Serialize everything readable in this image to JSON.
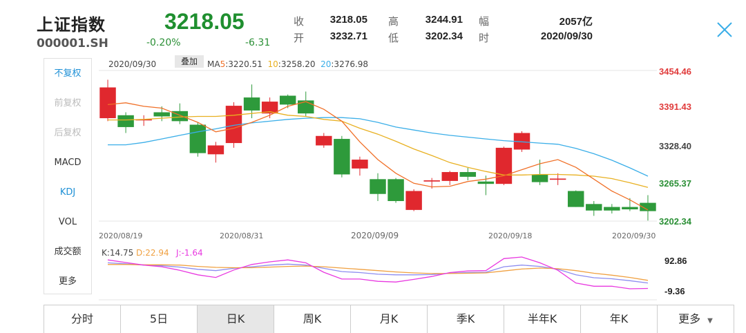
{
  "header": {
    "name": "上证指数",
    "code": "000001.SH",
    "price": "3218.05",
    "change_pct": "-0.20%",
    "change": "-6.31",
    "stats": [
      {
        "label": "收",
        "value": "3218.05"
      },
      {
        "label": "高",
        "value": "3244.91"
      },
      {
        "label": "幅",
        "value": "2057亿"
      },
      {
        "label": "开",
        "value": "3232.71"
      },
      {
        "label": "低",
        "value": "3202.34"
      },
      {
        "label": "时",
        "value": "2020/09/30"
      }
    ]
  },
  "sidebar": {
    "items": [
      {
        "label": "不复权",
        "state": "selected"
      },
      {
        "label": "前复权",
        "state": "disabled"
      },
      {
        "label": "后复权",
        "state": "disabled"
      },
      {
        "label": "MACD",
        "state": "normal"
      },
      {
        "label": "KDJ",
        "state": "selected"
      },
      {
        "label": "VOL",
        "state": "normal"
      },
      {
        "label": "成交额",
        "state": "normal"
      },
      {
        "label": "更多",
        "state": "normal"
      }
    ]
  },
  "legend": {
    "date": "2020/09/30",
    "overlay_button": "叠加",
    "ma5_prefix": "MA",
    "ma5_num": "5",
    "ma5_value": ":3220.51",
    "ma10_num": "10",
    "ma10_value": ":3258.20",
    "ma20_num": "20",
    "ma20_value": ":3276.98"
  },
  "price_axis": {
    "ticks": [
      "3454.46",
      "3391.43",
      "3328.40",
      "3265.37",
      "3202.34"
    ],
    "tick_colors": [
      "#e03a3a",
      "#e03a3a",
      "#444444",
      "#2a8f35",
      "#2a8f35"
    ]
  },
  "date_axis": [
    "2020/08/19",
    "2020/08/31",
    "2020/09/09",
    "2020/09/18",
    "2020/09/30"
  ],
  "kdj": {
    "k_label": "K:14.75",
    "d_label": "D:22.94",
    "j_label": "J:-1.64",
    "ticks": [
      "92.86",
      "-9.36"
    ]
  },
  "tabs": [
    "分时",
    "5日",
    "日K",
    "周K",
    "月K",
    "季K",
    "半年K",
    "年K",
    "更多"
  ],
  "active_tab": "日K",
  "colors": {
    "up": "#e0282e",
    "down": "#2e9a3b",
    "ma5": "#f07028",
    "ma10": "#e8b020",
    "ma20": "#3aaee8",
    "k": "#8c8cf0",
    "d": "#f0a040",
    "j": "#e838e0",
    "accent": "#1e90d6"
  },
  "chart_data": {
    "type": "candlestick",
    "ylim": [
      3202.34,
      3454.46
    ],
    "candles": [
      {
        "o": 3375,
        "c": 3427,
        "h": 3440,
        "l": 3370
      },
      {
        "o": 3380,
        "c": 3360,
        "h": 3385,
        "l": 3350
      },
      {
        "o": 3372,
        "c": 3373,
        "h": 3380,
        "l": 3362
      },
      {
        "o": 3385,
        "c": 3378,
        "h": 3395,
        "l": 3370
      },
      {
        "o": 3387,
        "c": 3370,
        "h": 3400,
        "l": 3365
      },
      {
        "o": 3364,
        "c": 3316,
        "h": 3368,
        "l": 3310
      },
      {
        "o": 3314,
        "c": 3329,
        "h": 3335,
        "l": 3300
      },
      {
        "o": 3333,
        "c": 3396,
        "h": 3402,
        "l": 3325
      },
      {
        "o": 3410,
        "c": 3388,
        "h": 3432,
        "l": 3375
      },
      {
        "o": 3383,
        "c": 3403,
        "h": 3410,
        "l": 3375
      },
      {
        "o": 3413,
        "c": 3398,
        "h": 3415,
        "l": 3392
      },
      {
        "o": 3405,
        "c": 3383,
        "h": 3420,
        "l": 3378
      },
      {
        "o": 3329,
        "c": 3345,
        "h": 3350,
        "l": 3325
      },
      {
        "o": 3340,
        "c": 3280,
        "h": 3345,
        "l": 3275
      },
      {
        "o": 3290,
        "c": 3305,
        "h": 3310,
        "l": 3278
      },
      {
        "o": 3272,
        "c": 3247,
        "h": 3282,
        "l": 3235
      },
      {
        "o": 3272,
        "c": 3235,
        "h": 3274,
        "l": 3232
      },
      {
        "o": 3220,
        "c": 3252,
        "h": 3255,
        "l": 3218
      },
      {
        "o": 3268,
        "c": 3270,
        "h": 3274,
        "l": 3256
      },
      {
        "o": 3269,
        "c": 3284,
        "h": 3286,
        "l": 3262
      },
      {
        "o": 3284,
        "c": 3276,
        "h": 3291,
        "l": 3270
      },
      {
        "o": 3268,
        "c": 3264,
        "h": 3278,
        "l": 3245
      },
      {
        "o": 3264,
        "c": 3325,
        "h": 3327,
        "l": 3262
      },
      {
        "o": 3322,
        "c": 3350,
        "h": 3353,
        "l": 3318
      },
      {
        "o": 3280,
        "c": 3267,
        "h": 3305,
        "l": 3262
      },
      {
        "o": 3271,
        "c": 3273,
        "h": 3282,
        "l": 3262
      },
      {
        "o": 3252,
        "c": 3225,
        "h": 3253,
        "l": 3225
      },
      {
        "o": 3230,
        "c": 3219,
        "h": 3235,
        "l": 3210
      },
      {
        "o": 3225,
        "c": 3219,
        "h": 3230,
        "l": 3214
      },
      {
        "o": 3225,
        "c": 3221,
        "h": 3240,
        "l": 3218
      },
      {
        "o": 3232,
        "c": 3218,
        "h": 3245,
        "l": 3202
      }
    ],
    "ma5": [
      3398,
      3401,
      3395,
      3392,
      3380,
      3368,
      3352,
      3358,
      3368,
      3380,
      3395,
      3403,
      3390,
      3370,
      3335,
      3305,
      3282,
      3265,
      3259,
      3260,
      3268,
      3272,
      3278,
      3288,
      3298,
      3305,
      3292,
      3272,
      3252,
      3237,
      3220
    ],
    "ma10": [
      3372,
      3372,
      3373,
      3375,
      3377,
      3378,
      3378,
      3380,
      3383,
      3386,
      3380,
      3378,
      3373,
      3370,
      3358,
      3348,
      3336,
      3323,
      3312,
      3300,
      3292,
      3285,
      3279,
      3279,
      3280,
      3280,
      3279,
      3277,
      3273,
      3266,
      3258
    ],
    "ma20": [
      3330,
      3330,
      3334,
      3340,
      3346,
      3352,
      3357,
      3363,
      3367,
      3370,
      3373,
      3375,
      3376,
      3376,
      3374,
      3368,
      3360,
      3355,
      3350,
      3346,
      3343,
      3340,
      3337,
      3335,
      3333,
      3331,
      3324,
      3315,
      3304,
      3291,
      3277
    ],
    "k": [
      77,
      74,
      70,
      68,
      64,
      57,
      53,
      60,
      65,
      70,
      73,
      70,
      60,
      50,
      47,
      42,
      40,
      40,
      41,
      45,
      47,
      48,
      65,
      70,
      66,
      57,
      40,
      31,
      28,
      22,
      15
    ],
    "d": [
      72,
      72,
      71,
      71,
      70,
      66,
      63,
      62,
      62,
      64,
      66,
      67,
      65,
      61,
      57,
      53,
      49,
      46,
      44,
      44,
      45,
      46,
      52,
      58,
      61,
      59,
      53,
      45,
      39,
      32,
      23
    ],
    "j": [
      86,
      78,
      70,
      65,
      54,
      40,
      32,
      55,
      72,
      80,
      86,
      77,
      48,
      27,
      27,
      20,
      18,
      26,
      35,
      47,
      52,
      53,
      90,
      95,
      77,
      54,
      15,
      5,
      5,
      -3,
      -2
    ],
    "kdj_ylim": [
      -9.36,
      92.86
    ]
  }
}
